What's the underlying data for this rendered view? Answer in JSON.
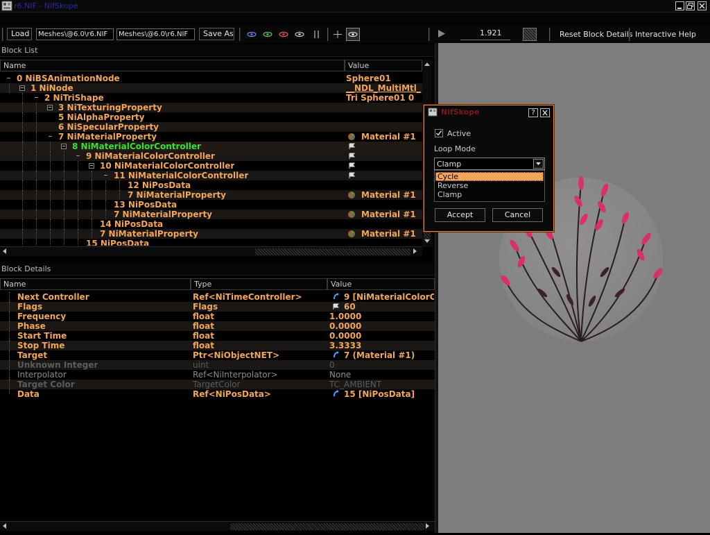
{
  "window": {
    "title": "r6.NIF - NifSkope"
  },
  "toolbar": {
    "load_label": "Load",
    "load_path": "Meshes\\@6.0\\r6.NIF",
    "save_path": "Meshes\\@6.0\\r6.NIF",
    "save_label": "Save As",
    "time_value": "1.921",
    "reset_label": "Reset Block Details",
    "help_label": "Interactive Help"
  },
  "block_list": {
    "title": "Block List",
    "columns": [
      "Name",
      "Value"
    ],
    "rows": [
      {
        "name": "0 NiBSAnimationNode",
        "value": "Sphere01"
      },
      {
        "name": "1 NiNode",
        "value": "__NDL_MultiMtl_"
      },
      {
        "name": "2 NiTriShape",
        "value": "Tri Sphere01 0"
      },
      {
        "name": "3 NiTexturingProperty",
        "value": ""
      },
      {
        "name": "5 NiAlphaProperty",
        "value": ""
      },
      {
        "name": "6 NiSpecularProperty",
        "value": ""
      },
      {
        "name": "7 NiMaterialProperty",
        "value": "Material #1"
      },
      {
        "name": "8 NiMaterialColorController",
        "value": ""
      },
      {
        "name": "9 NiMaterialColorController",
        "value": ""
      },
      {
        "name": "10 NiMaterialColorController",
        "value": ""
      },
      {
        "name": "11 NiMaterialColorController",
        "value": ""
      },
      {
        "name": "12 NiPosData",
        "value": ""
      },
      {
        "name": "7 NiMaterialProperty",
        "value": "Material #1"
      },
      {
        "name": "13 NiPosData",
        "value": ""
      },
      {
        "name": "7 NiMaterialProperty",
        "value": "Material #1"
      },
      {
        "name": "14 NiPosData",
        "value": ""
      },
      {
        "name": "7 NiMaterialProperty",
        "value": "Material #1"
      },
      {
        "name": "15 NiPosData",
        "value": ""
      }
    ]
  },
  "block_details": {
    "title": "Block Details",
    "columns": [
      "Name",
      "Type",
      "Value"
    ],
    "rows": [
      {
        "name": "Next Controller",
        "type": "Ref<NiTimeController>",
        "value": "9 [NiMaterialColorCo"
      },
      {
        "name": "Flags",
        "type": "Flags",
        "value": "60"
      },
      {
        "name": "Frequency",
        "type": "float",
        "value": "1.0000"
      },
      {
        "name": "Phase",
        "type": "float",
        "value": "0.0000"
      },
      {
        "name": "Start Time",
        "type": "float",
        "value": "0.0000"
      },
      {
        "name": "Stop Time",
        "type": "float",
        "value": "3.3333"
      },
      {
        "name": "Target",
        "type": "Ptr<NiObjectNET>",
        "value": "7 (Material #1)"
      },
      {
        "name": "Unknown Integer",
        "type": "uint",
        "value": "0"
      },
      {
        "name": "Interpolator",
        "type": "Ref<NiInterpolator>",
        "value": "None"
      },
      {
        "name": "Target Color",
        "type": "TargetColor",
        "value": "TC_AMBIENT"
      },
      {
        "name": "Data",
        "type": "Ref<NiPosData>",
        "value": "15 [NiPosData]"
      }
    ]
  },
  "dialog": {
    "title": "NifSkope",
    "help_btn": "?",
    "close_btn": "X",
    "active_label": "Active",
    "loop_mode_label": "Loop Mode",
    "selected": "Clamp",
    "options": [
      "Cycle",
      "Reverse",
      "Clamp"
    ],
    "accept_label": "Accept",
    "cancel_label": "Cancel"
  },
  "colors": {
    "accent_orange": "#f2a65a",
    "selected_green": "#38e038",
    "disabled_gray": "#5c5c5c",
    "viewport_bg": "#7d7d7d"
  }
}
